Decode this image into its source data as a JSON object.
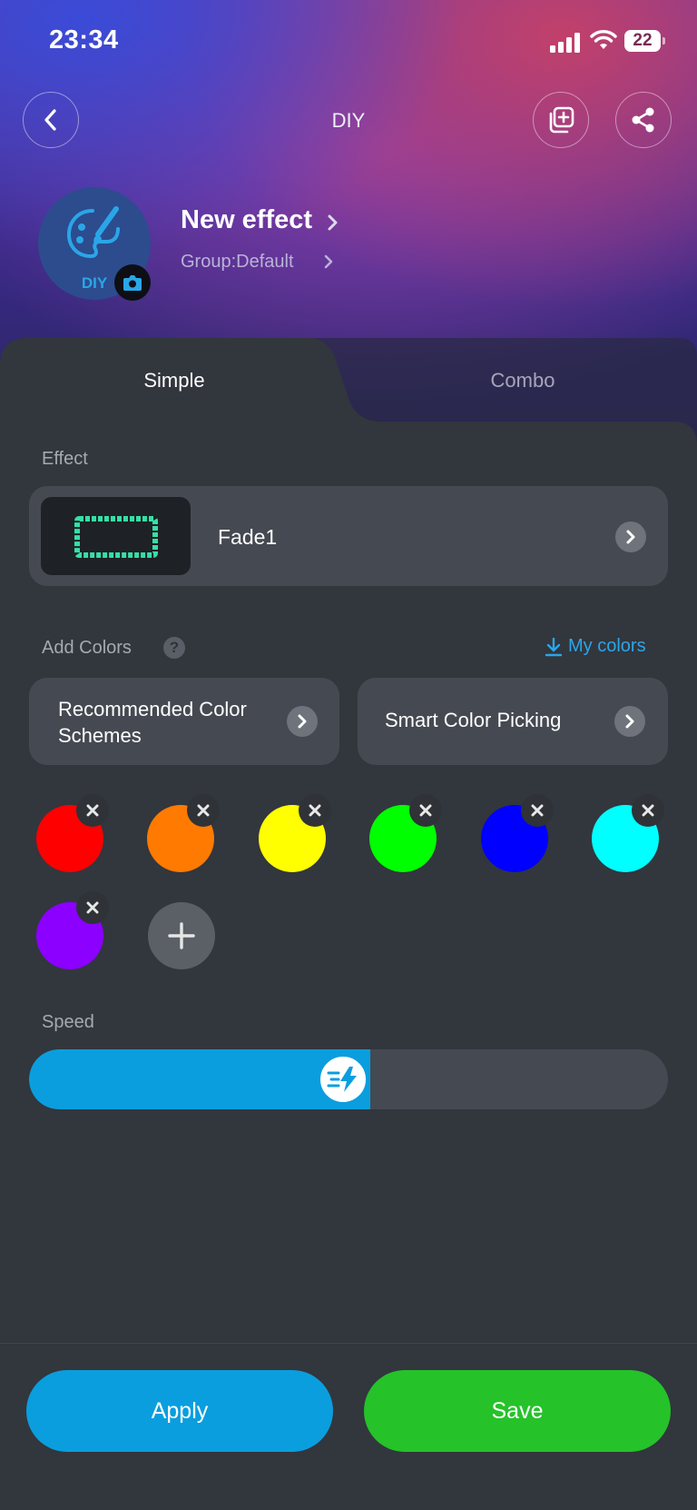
{
  "status_bar": {
    "time": "23:34",
    "battery": "22",
    "icons": [
      "cellular-signal-icon",
      "wifi-icon",
      "battery-icon"
    ]
  },
  "nav": {
    "title": "DIY",
    "back_icon": "chevron-left-icon",
    "duplicate_icon": "copy-add-icon",
    "share_icon": "share-icon"
  },
  "header": {
    "avatar_label": "DIY",
    "avatar_icon": "palette-brush-icon",
    "camera_icon": "camera-icon",
    "effect_name": "New effect",
    "group": "Group:Default"
  },
  "tabs": [
    {
      "label": "Simple",
      "active": true
    },
    {
      "label": "Combo",
      "active": false
    }
  ],
  "effect_section": {
    "label": "Effect",
    "selected_effect": "Fade1"
  },
  "colors_section": {
    "label": "Add Colors",
    "help": "?",
    "my_colors": "My colors",
    "recommended": "Recommended Color Schemes",
    "smart_picking": "Smart Color Picking",
    "swatches": [
      "#ff0000",
      "#ff7a00",
      "#ffff00",
      "#00ff00",
      "#0000ff",
      "#00ffff",
      "#8b00ff"
    ]
  },
  "speed_section": {
    "label": "Speed",
    "value_fraction": 0.5
  },
  "actions": {
    "apply": "Apply",
    "save": "Save"
  },
  "colors": {
    "accent_blue": "#0a9ede",
    "save_green": "#25c22a",
    "panel": "#32363d",
    "card": "#454a52"
  }
}
